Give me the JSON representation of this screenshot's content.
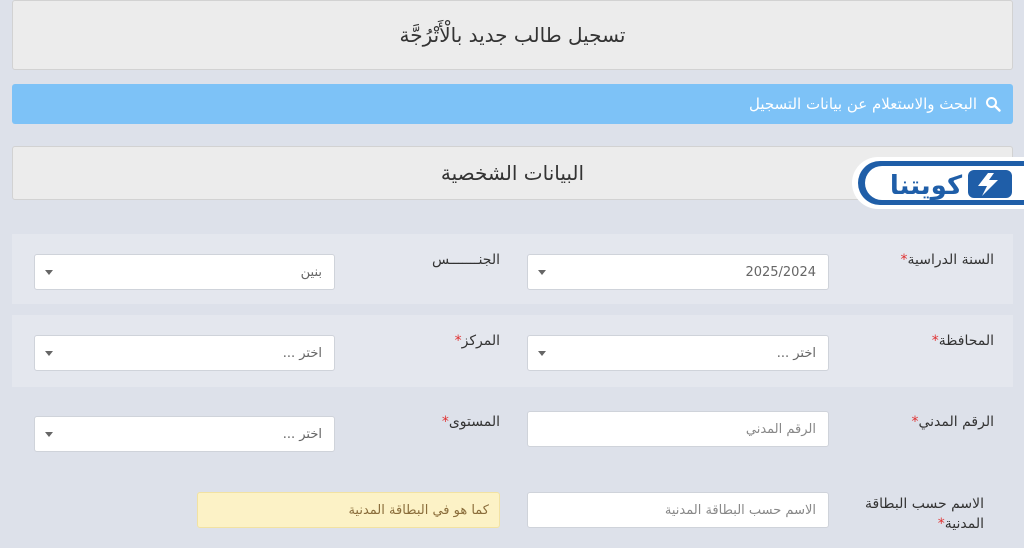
{
  "page": {
    "title": "تسجيل طالب جديد بالْأَتْرُجَّة"
  },
  "search": {
    "label": "البحث والاستعلام عن بيانات التسجيل"
  },
  "section": {
    "title": "البيانات الشخصية"
  },
  "logo": {
    "text": "كويتنا"
  },
  "form": {
    "academic_year": {
      "label": "السنة الدراسية",
      "value": "2025/2024"
    },
    "gender": {
      "label": "الجنـــــــس",
      "value": "بنين"
    },
    "governorate": {
      "label": "المحافظة",
      "value": "اختر ..."
    },
    "center": {
      "label": "المركز",
      "value": "اختر ..."
    },
    "civil_id": {
      "label": "الرقم المدني",
      "placeholder": "الرقم المدني"
    },
    "level": {
      "label": "المستوى",
      "value": "اختر ..."
    },
    "name": {
      "label": "الاسم حسب البطاقة المدنية",
      "placeholder": "الاسم حسب البطاقة المدنية",
      "hint": "كما هو في البطاقة المدنية"
    },
    "required_mark": "*"
  },
  "colors": {
    "accent_blue": "#7dc2f7",
    "logo_blue": "#1f5ea8",
    "required": "#e03030",
    "hint_bg": "#fcf2c6"
  }
}
